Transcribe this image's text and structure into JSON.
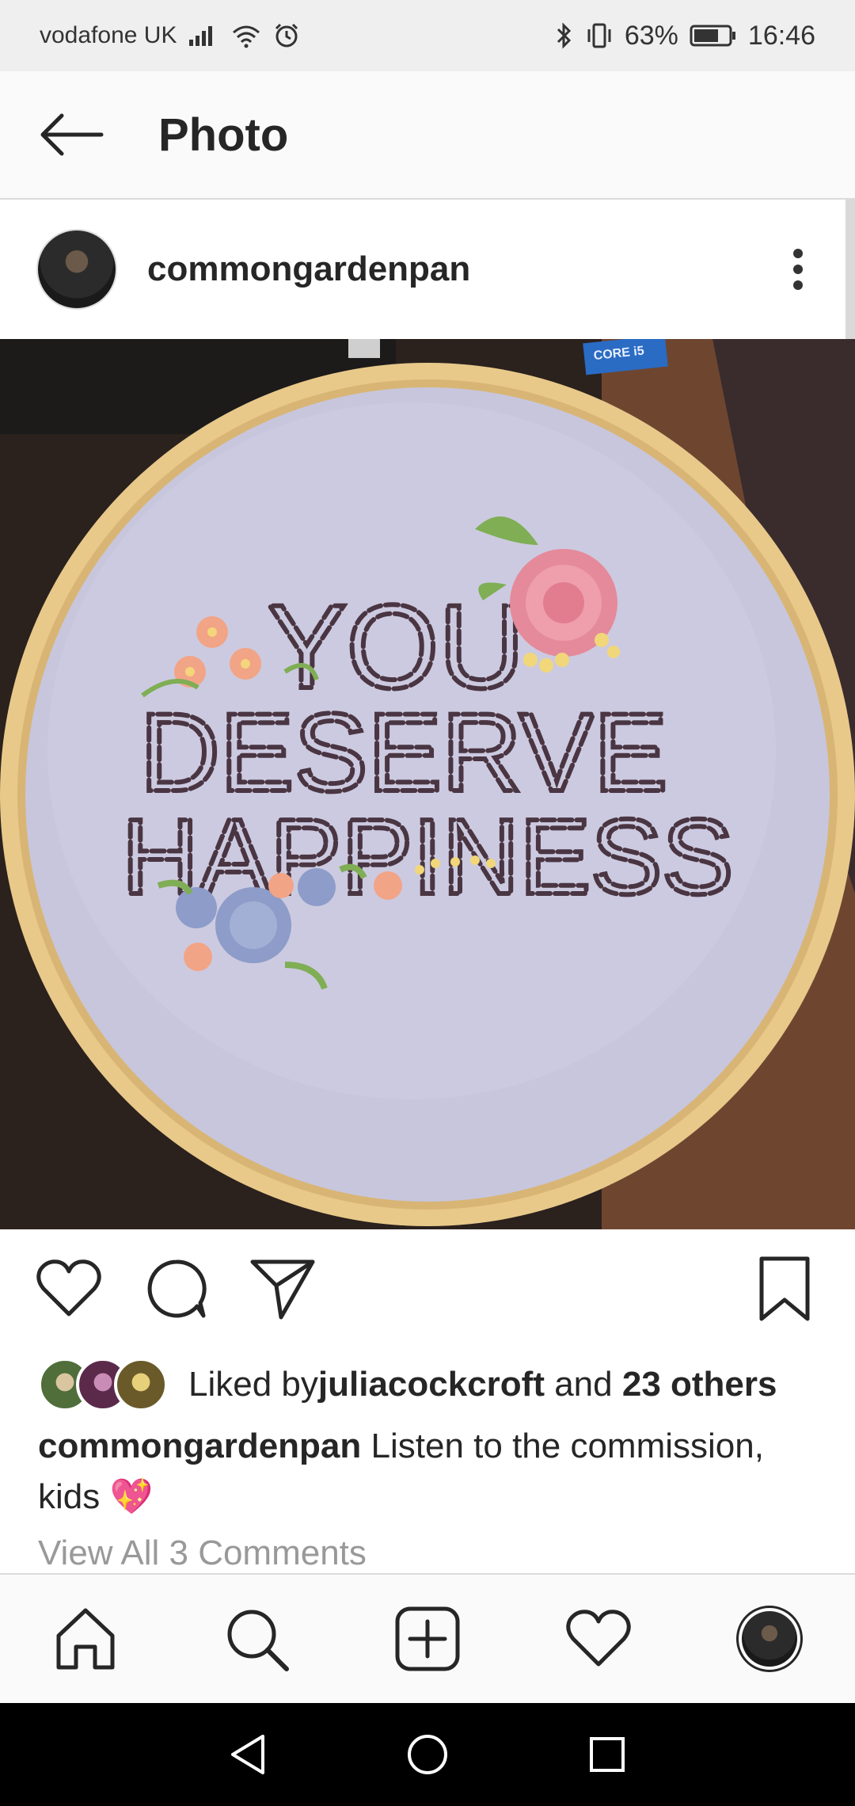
{
  "status_bar": {
    "carrier": "vodafone UK",
    "battery": "63%",
    "time": "16:46"
  },
  "header": {
    "title": "Photo"
  },
  "post": {
    "username": "commongardenpan",
    "image_text": {
      "line1": "YOU",
      "line2": "DESERVE",
      "line3": "HAPPINESS",
      "tag": "CORE i5"
    },
    "likes": {
      "prefix": "Liked by ",
      "user": "juliacockcroft",
      "middle": " and ",
      "others": "23 others"
    },
    "caption": {
      "username": "commongardenpan",
      "text": " Listen to the commission, kids ",
      "emoji": "💖"
    },
    "view_comments": "View All 3 Comments"
  },
  "colors": {
    "fabric": "#c9c8de",
    "hoop": "#e3c27f",
    "thread": "#4a3542",
    "rose": "#e58a9a",
    "blue_flower": "#8d9cc9",
    "peach_flower": "#f2a486",
    "leaf": "#7fae55"
  },
  "icons": {
    "back": "arrow-left-icon",
    "more": "more-vertical-icon",
    "like": "heart-icon",
    "comment": "comment-icon",
    "share": "send-icon",
    "save": "bookmark-icon",
    "home": "home-icon",
    "search": "search-icon",
    "add": "add-post-icon",
    "activity": "heart-icon",
    "profile": "profile-avatar"
  }
}
